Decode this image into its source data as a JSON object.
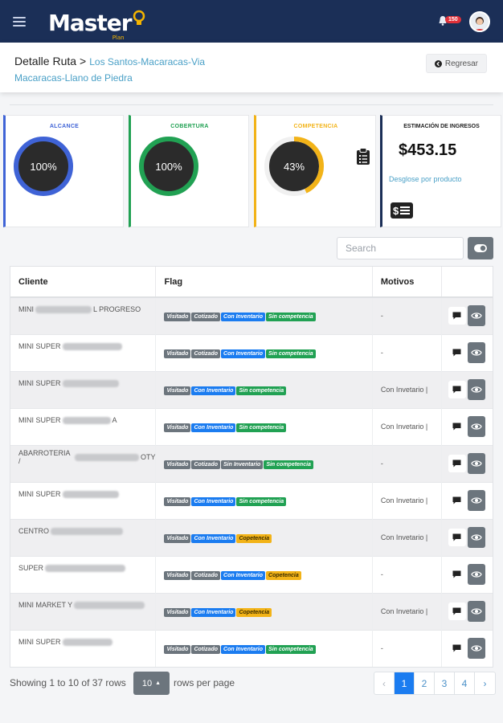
{
  "navbar": {
    "logo_text": "Master",
    "logo_sub": "Plan",
    "notif_count": "150"
  },
  "header": {
    "title": "Detalle Ruta",
    "separator": ">",
    "route": "Los Santos-Macaracas-Via Macaracas-Llano de Piedra",
    "back_label": "Regresar"
  },
  "stats": {
    "alcance": {
      "title": "ALCANCE",
      "value": "100%",
      "fraction": 1.0,
      "color": "#3f63d6"
    },
    "cobertura": {
      "title": "COBERTURA",
      "value": "100%",
      "fraction": 1.0,
      "color": "#21a153"
    },
    "competencia": {
      "title": "COMPETENCIA",
      "value": "43%",
      "fraction": 0.43,
      "color": "#f2b318"
    },
    "income": {
      "title": "ESTIMACIÓN DE INGRESOS",
      "value": "$453.15",
      "link": "Desglose por producto"
    }
  },
  "toolbar": {
    "search_placeholder": "Search"
  },
  "table": {
    "headers": [
      "Cliente",
      "Flag",
      "Motivos",
      ""
    ],
    "rows": [
      {
        "prefix": "MINI",
        "suffix": "L PROGRESO",
        "flags": [
          "Visitado",
          "Cotizado",
          "Con Inventario",
          "Sin competencia"
        ],
        "motivos": "-"
      },
      {
        "prefix": "MINI SUPER",
        "suffix": "",
        "flags": [
          "Visitado",
          "Cotizado",
          "Con Inventario",
          "Sin competencia"
        ],
        "motivos": "-"
      },
      {
        "prefix": "MINI SUPER",
        "suffix": "",
        "flags": [
          "Visitado",
          "Con Inventario",
          "Sin competencia"
        ],
        "motivos": "Con Invetario |"
      },
      {
        "prefix": "MINI SUPER",
        "suffix": "A",
        "flags": [
          "Visitado",
          "Con Inventario",
          "Sin competencia"
        ],
        "motivos": "Con Invetario |"
      },
      {
        "prefix": "ABARROTERIA /",
        "suffix": "OTY",
        "flags": [
          "Visitado",
          "Cotizado",
          "Sin Inventario",
          "Sin competencia"
        ],
        "motivos": "-"
      },
      {
        "prefix": "MINI SUPER",
        "suffix": "",
        "flags": [
          "Visitado",
          "Con Inventario",
          "Sin competencia"
        ],
        "motivos": "Con Invetario |"
      },
      {
        "prefix": "CENTRO",
        "suffix": "",
        "flags": [
          "Visitado",
          "Con Inventario",
          "Copetencia"
        ],
        "motivos": "Con Invetario |"
      },
      {
        "prefix": "SUPER",
        "suffix": "",
        "flags": [
          "Visitado",
          "Cotizado",
          "Con Inventario",
          "Copetencia"
        ],
        "motivos": "-"
      },
      {
        "prefix": "MINI MARKET Y",
        "suffix": "",
        "flags": [
          "Visitado",
          "Con Inventario",
          "Copetencia"
        ],
        "motivos": "Con Invetario |"
      },
      {
        "prefix": "MINI SUPER",
        "suffix": "",
        "flags": [
          "Visitado",
          "Cotizado",
          "Con Inventario",
          "Sin competencia"
        ],
        "motivos": "-"
      }
    ]
  },
  "flag_colors": {
    "Visitado": "#6c757d",
    "Cotizado": "#6c757d",
    "Con Inventario": "#1b7cf0",
    "Sin Inventario": "#6c757d",
    "Sin competencia": "#21a153",
    "Copetencia": "#f2b318"
  },
  "footer": {
    "showing": "Showing 1 to 10 of 37 rows",
    "page_size": "10",
    "rows_per_page": "rows per page",
    "pages": [
      "‹",
      "1",
      "2",
      "3",
      "4",
      "›"
    ],
    "active_page": "1"
  }
}
